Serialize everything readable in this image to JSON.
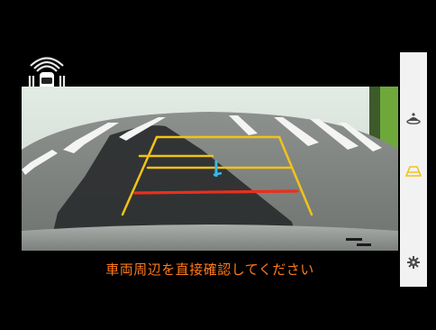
{
  "camera_view": {
    "warning_message": "車両周辺を直接確認してください"
  },
  "sidebar": {
    "buttons": [
      {
        "id": "view-mode",
        "icon": "top-down-view-icon"
      },
      {
        "id": "guidelines",
        "icon": "parking-guide-icon"
      },
      {
        "id": "settings",
        "icon": "gear-icon"
      }
    ]
  },
  "colors": {
    "warning_text": "#ff7a1a",
    "guide_yellow": "#f2c218",
    "guide_red": "#e8301e",
    "center_marker": "#3ab8e8",
    "sensor_ring": "#e8e8e8"
  },
  "icons": {
    "sensor_display": "parking-sensor-icon"
  }
}
